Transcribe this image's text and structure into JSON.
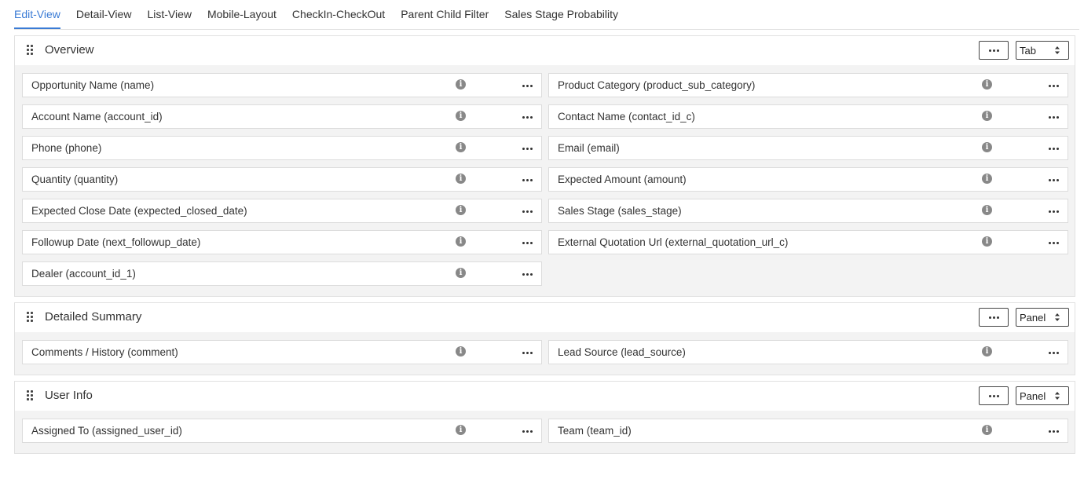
{
  "tabs": [
    {
      "label": "Edit-View",
      "active": true
    },
    {
      "label": "Detail-View",
      "active": false
    },
    {
      "label": "List-View",
      "active": false
    },
    {
      "label": "Mobile-Layout",
      "active": false
    },
    {
      "label": "CheckIn-CheckOut",
      "active": false
    },
    {
      "label": "Parent Child Filter",
      "active": false
    },
    {
      "label": "Sales Stage Probability",
      "active": false
    }
  ],
  "panels": [
    {
      "title": "Overview",
      "type_select": "Tab",
      "fields": [
        "Opportunity Name (name)",
        "Product Category (product_sub_category)",
        "Account Name (account_id)",
        "Contact Name (contact_id_c)",
        "Phone (phone)",
        "Email (email)",
        "Quantity (quantity)",
        "Expected Amount (amount)",
        "Expected Close Date (expected_closed_date)",
        "Sales Stage (sales_stage)",
        "Followup Date (next_followup_date)",
        "External Quotation Url (external_quotation_url_c)",
        "Dealer (account_id_1)"
      ]
    },
    {
      "title": "Detailed Summary",
      "type_select": "Panel",
      "fields": [
        "Comments / History (comment)",
        "Lead Source (lead_source)"
      ]
    },
    {
      "title": "User Info",
      "type_select": "Panel",
      "fields": [
        "Assigned To (assigned_user_id)",
        "Team (team_id)"
      ]
    }
  ],
  "icons": {
    "info": "info-icon",
    "more": "more-icon",
    "drag": "drag-handle-icon",
    "caret": "sort-caret-icon"
  },
  "colors": {
    "accent": "#3a7bd5",
    "panel_body": "#f3f3f3",
    "icon_gray": "#888888"
  }
}
